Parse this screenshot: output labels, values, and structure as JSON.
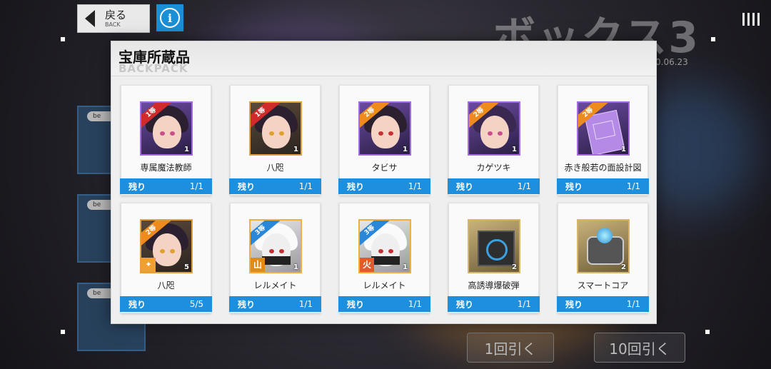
{
  "header": {
    "back_label": "戻る",
    "back_sub": "BACK",
    "info_glyph": "i",
    "banner_text": "ボックス3",
    "banner_date": "0.06.23"
  },
  "side_cards": [
    {
      "label": "be"
    },
    {
      "label": "be"
    },
    {
      "label": "be"
    }
  ],
  "draw_buttons": {
    "once": "1回引く",
    "ten": "10回引く"
  },
  "panel": {
    "title": "宝庫所蔵品",
    "subtitle": "BACKPACK",
    "remain_label": "残り",
    "items": [
      {
        "name": "専属魔法教師",
        "rank": "1等",
        "count": "1",
        "remaining": "1/1",
        "icon": "character-portrait"
      },
      {
        "name": "八咫",
        "rank": "1等",
        "count": "1",
        "remaining": "1/1",
        "icon": "character-portrait"
      },
      {
        "name": "タビサ",
        "rank": "2等",
        "count": "1",
        "remaining": "1/1",
        "icon": "character-portrait"
      },
      {
        "name": "カゲツキ",
        "rank": "2等",
        "count": "1",
        "remaining": "1/1",
        "icon": "character-portrait"
      },
      {
        "name": "赤き般若の面設計図",
        "rank": "2等",
        "count": "1",
        "remaining": "1/1",
        "icon": "blueprint-icon"
      },
      {
        "name": "八咫",
        "rank": "2等",
        "count": "5",
        "remaining": "5/5",
        "icon": "character-fragment"
      },
      {
        "name": "レルメイト",
        "rank": "3等",
        "count": "1",
        "remaining": "1/1",
        "element": "山",
        "icon": "character-portrait"
      },
      {
        "name": "レルメイト",
        "rank": "3等",
        "count": "1",
        "remaining": "1/1",
        "element": "火",
        "icon": "character-portrait"
      },
      {
        "name": "高誘導爆破弾",
        "rank": "",
        "count": "2",
        "remaining": "1/1",
        "icon": "bomb-device-icon"
      },
      {
        "name": "スマートコア",
        "rank": "",
        "count": "2",
        "remaining": "1/1",
        "icon": "smart-core-icon"
      }
    ]
  }
}
